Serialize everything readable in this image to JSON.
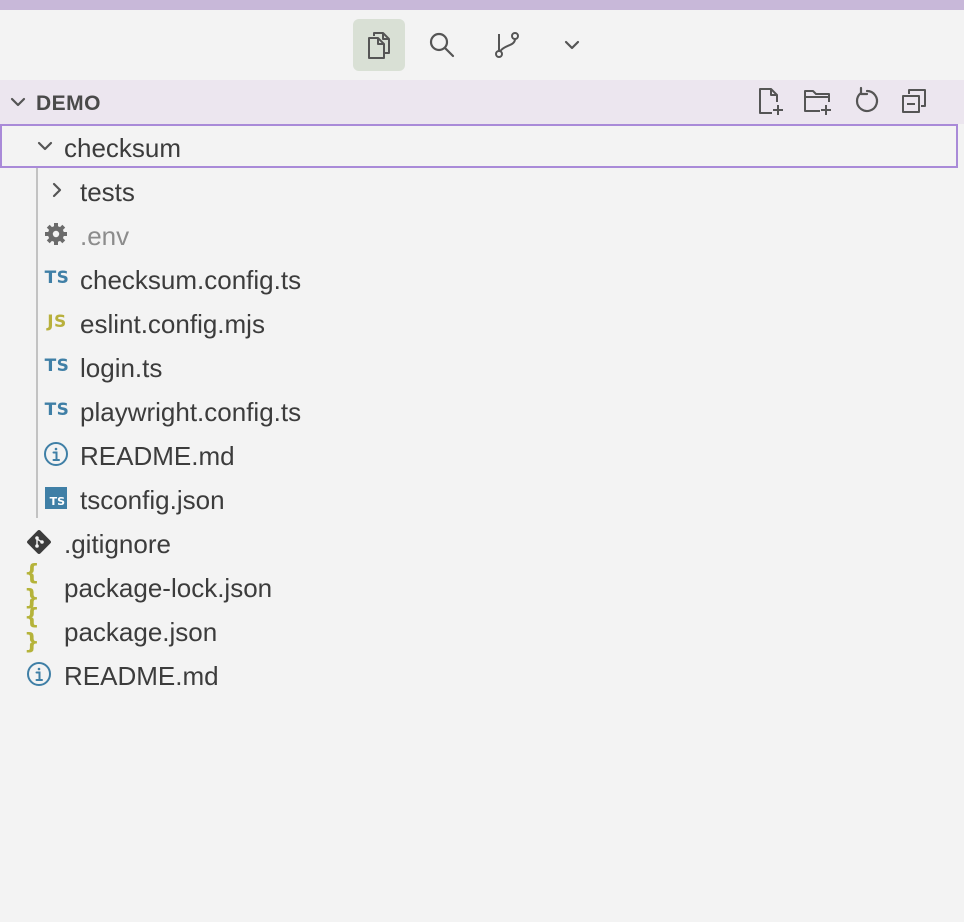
{
  "activity_bar": {
    "items": [
      {
        "name": "explorer",
        "icon": "files-icon",
        "active": true
      },
      {
        "name": "search",
        "icon": "search-icon",
        "active": false
      },
      {
        "name": "source-control",
        "icon": "source-control-icon",
        "active": false
      },
      {
        "name": "more",
        "icon": "chevron-down-icon",
        "active": false
      }
    ]
  },
  "explorer": {
    "section_title": "DEMO",
    "actions": [
      {
        "name": "new-file",
        "icon": "new-file-icon"
      },
      {
        "name": "new-folder",
        "icon": "new-folder-icon"
      },
      {
        "name": "refresh",
        "icon": "refresh-icon"
      },
      {
        "name": "collapse-all",
        "icon": "collapse-all-icon"
      }
    ],
    "tree": [
      {
        "label": "checksum",
        "type": "folder",
        "expanded": true,
        "depth": 0,
        "focused": true
      },
      {
        "label": "tests",
        "type": "folder",
        "expanded": false,
        "depth": 1
      },
      {
        "label": ".env",
        "type": "file",
        "icon": "gear-icon",
        "depth": 1,
        "dimmed": true
      },
      {
        "label": "checksum.config.ts",
        "type": "file",
        "icon": "ts-icon",
        "badge": "TS",
        "depth": 1
      },
      {
        "label": "eslint.config.mjs",
        "type": "file",
        "icon": "js-icon",
        "badge": "JS",
        "depth": 1
      },
      {
        "label": "login.ts",
        "type": "file",
        "icon": "ts-icon",
        "badge": "TS",
        "depth": 1
      },
      {
        "label": "playwright.config.ts",
        "type": "file",
        "icon": "ts-icon",
        "badge": "TS",
        "depth": 1
      },
      {
        "label": "README.md",
        "type": "file",
        "icon": "info-icon",
        "depth": 1
      },
      {
        "label": "tsconfig.json",
        "type": "file",
        "icon": "tsconfig-icon",
        "badge": "TS",
        "depth": 1
      },
      {
        "label": ".gitignore",
        "type": "file",
        "icon": "git-icon",
        "depth": 0
      },
      {
        "label": "package-lock.json",
        "type": "file",
        "icon": "json-icon",
        "badge": "{ }",
        "depth": 0
      },
      {
        "label": "package.json",
        "type": "file",
        "icon": "json-icon",
        "badge": "{ }",
        "depth": 0
      },
      {
        "label": "README.md",
        "type": "file",
        "icon": "info-icon",
        "depth": 0
      }
    ]
  },
  "colors": {
    "top_strip": "#c8b8d9",
    "header_bg": "#ece6ef",
    "focus_border": "#a98ad8",
    "ts": "#3f7fa6",
    "js": "#b8b03c",
    "json": "#b5b33a",
    "info": "#3f7fa6"
  }
}
